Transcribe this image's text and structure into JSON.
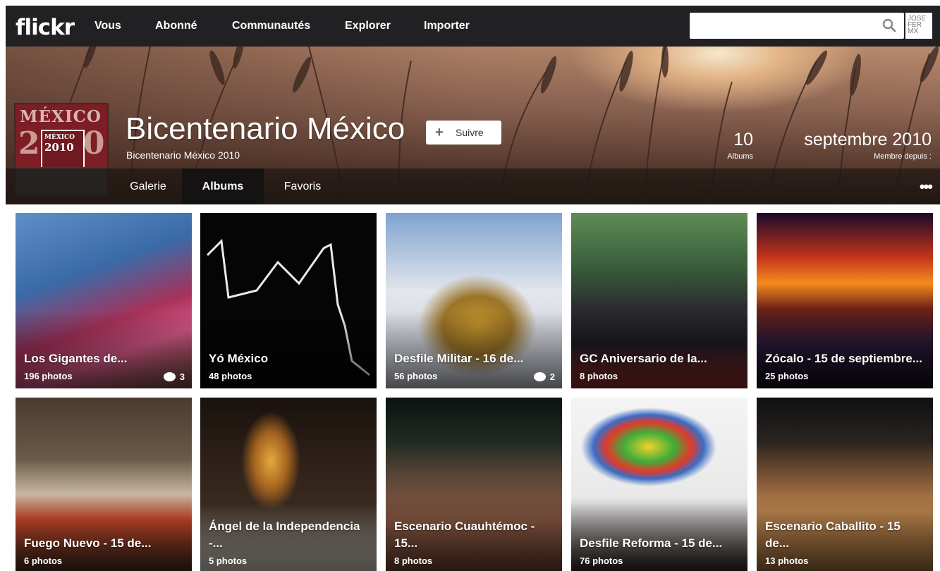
{
  "topnav": {
    "logo": "flickr",
    "links": [
      "Vous",
      "Abonné",
      "Communautés",
      "Explorer",
      "Importer"
    ],
    "search": {
      "placeholder": "",
      "icon": "search-icon"
    },
    "avatar_text": "JOSE FER MX"
  },
  "profile": {
    "name": "Bicentenario México",
    "subtitle": "Bicentenario México 2010",
    "follow_label": "Suivre",
    "buddy_icon": {
      "line1": "MÉXICO",
      "line2": "2010",
      "inner1": "MÉXICO",
      "inner2": "2010"
    },
    "stats": [
      {
        "value": "10",
        "label": "Albums"
      },
      {
        "value": "septembre 2010",
        "label": "Membre depuis :"
      }
    ],
    "tabs": [
      {
        "label": "Galerie",
        "active": false
      },
      {
        "label": "Albums",
        "active": true
      },
      {
        "label": "Favoris",
        "active": false
      }
    ],
    "more_label": "•••"
  },
  "albums": [
    {
      "title": "Los Gigantes de...",
      "count": "196 photos",
      "comments": "3"
    },
    {
      "title": "Yó México",
      "count": "48 photos",
      "comments": ""
    },
    {
      "title": "Desfile Militar - 16 de...",
      "count": "56 photos",
      "comments": "2"
    },
    {
      "title": "GC Aniversario de la...",
      "count": "8 photos",
      "comments": ""
    },
    {
      "title": "Zócalo - 15 de septiembre...",
      "count": "25 photos",
      "comments": ""
    },
    {
      "title": "Fuego Nuevo - 15 de...",
      "count": "6 photos",
      "comments": ""
    },
    {
      "title": "Ángel de la Independencia -...",
      "count": "5 photos",
      "comments": ""
    },
    {
      "title": "Escenario Cuauhtémoc - 15...",
      "count": "8 photos",
      "comments": ""
    },
    {
      "title": "Desfile Reforma - 15 de...",
      "count": "76 photos",
      "comments": ""
    },
    {
      "title": "Escenario Caballito - 15 de...",
      "count": "13 photos",
      "comments": ""
    }
  ]
}
